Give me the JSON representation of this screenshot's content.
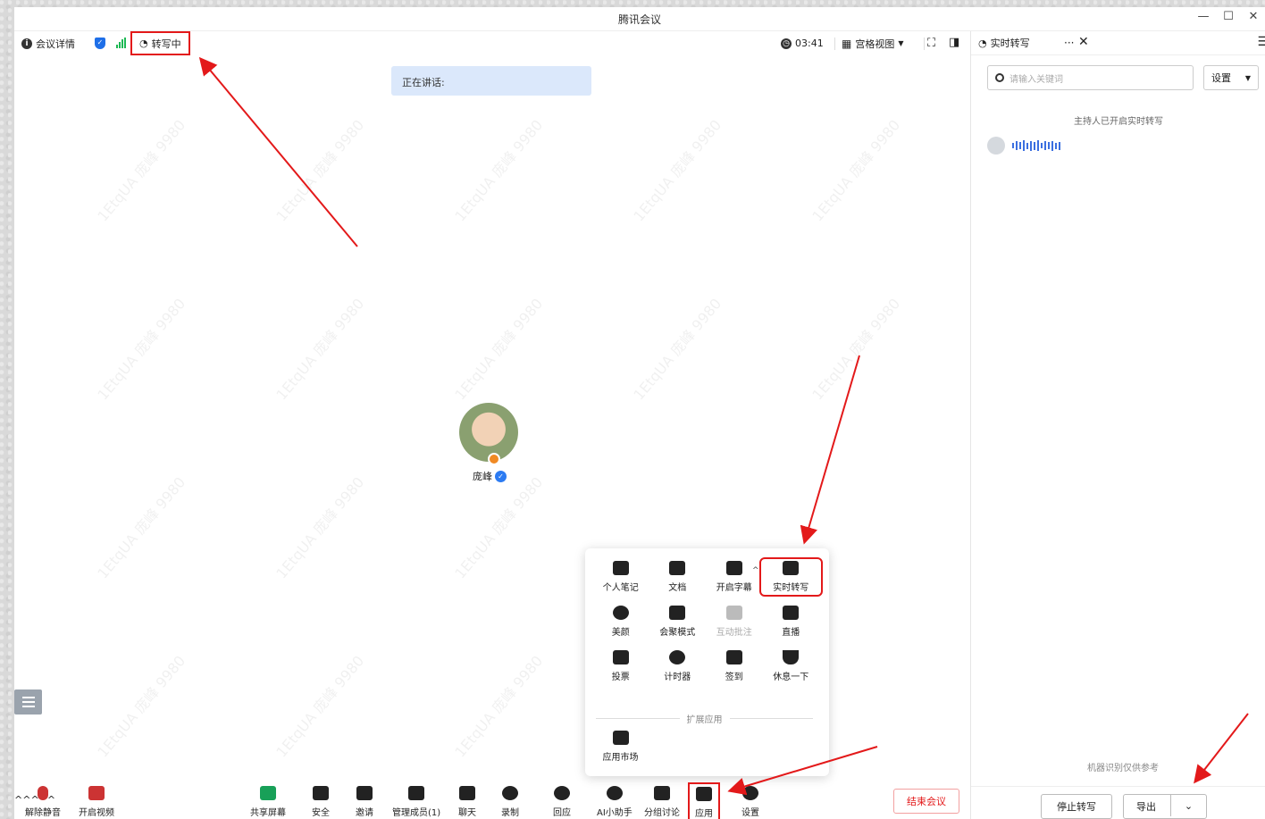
{
  "window": {
    "title": "腾讯会议"
  },
  "topbar": {
    "meeting_info": "会议详情",
    "transcribing": "转写中",
    "timer": "03:41",
    "view_mode": "宫格视图"
  },
  "stage": {
    "speaking_label": "正在讲话:",
    "participant_name": "庞峰",
    "watermark_text": "1EtqUA 庞峰 9980"
  },
  "apps_panel": {
    "items": [
      {
        "label": "个人笔记",
        "icon": "notebook-icon"
      },
      {
        "label": "文档",
        "icon": "document-icon"
      },
      {
        "label": "开启字幕",
        "icon": "caption-icon"
      },
      {
        "label": "实时转写",
        "icon": "transcribe-icon"
      },
      {
        "label": "美颜",
        "icon": "beauty-icon"
      },
      {
        "label": "会聚模式",
        "icon": "together-mode-icon"
      },
      {
        "label": "互动批注",
        "icon": "annotation-icon"
      },
      {
        "label": "直播",
        "icon": "live-icon"
      },
      {
        "label": "投票",
        "icon": "poll-icon"
      },
      {
        "label": "计时器",
        "icon": "timer-icon"
      },
      {
        "label": "签到",
        "icon": "checkin-icon"
      },
      {
        "label": "休息一下",
        "icon": "coffee-icon"
      }
    ],
    "extension_header": "扩展应用",
    "market_label": "应用市场"
  },
  "bottombar": {
    "unmute": "解除静音",
    "start_video": "开启视频",
    "share_screen": "共享屏幕",
    "security": "安全",
    "invite": "邀请",
    "members": "管理成员(1)",
    "chat": "聊天",
    "record": "录制",
    "react": "回应",
    "ai_assistant": "AI小助手",
    "breakout": "分组讨论",
    "apps": "应用",
    "settings": "设置",
    "end_meeting": "结束会议"
  },
  "sidepanel": {
    "title": "实时转写",
    "search_placeholder": "请输入关键词",
    "settings_label": "设置",
    "notice": "主持人已开启实时转写",
    "footnote": "机器识别仅供参考",
    "stop_label": "停止转写",
    "export_label": "导出"
  },
  "colors": {
    "accent_red": "#e3191a",
    "brand_blue": "#1e6fe8",
    "speaking_bg": "#dbe8fb",
    "signal_green": "#1db954"
  }
}
